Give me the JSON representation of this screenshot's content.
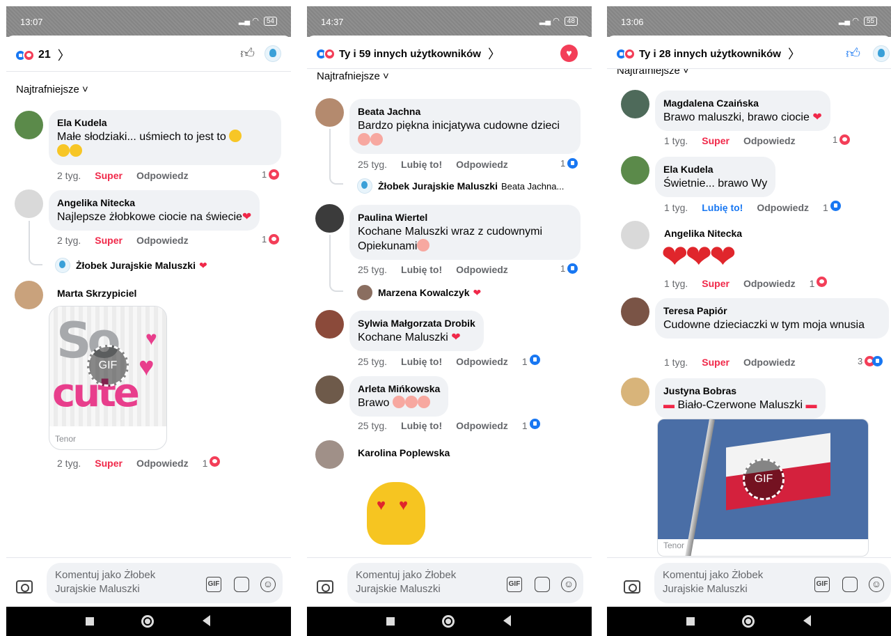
{
  "composer": {
    "placeholder": "Komentuj jako Żłobek Jurajskie Maluszki",
    "gif": "GIF"
  },
  "tenor": "Tenor",
  "gif_label": "GIF",
  "screens": [
    {
      "status_time": "13:07",
      "battery": "54",
      "header_count": "21",
      "sort_label": "Najtrafniejsze ˅",
      "comments": [
        {
          "name": "Ela Kudela",
          "text": "Małe słodziaki... uśmiech to jest to",
          "time": "2 tyg.",
          "reaction_label": "Super",
          "reply": "Odpowiedz",
          "count": "1"
        },
        {
          "name": "Angelika Nitecka",
          "text": "Najlepsze żłobkowe ciocie na świecie",
          "time": "2 tyg.",
          "reaction_label": "Super",
          "reply": "Odpowiedz",
          "count": "1",
          "reply_preview": {
            "name": "Żłobek Jurajskie Maluszki",
            "snippet": ""
          }
        },
        {
          "name": "Marta Skrzypiciel",
          "text": "",
          "time": "2 tyg.",
          "reaction_label": "Super",
          "reply": "Odpowiedz",
          "count": "1",
          "gif_art": "So cute"
        }
      ]
    },
    {
      "status_time": "14:37",
      "battery": "48",
      "header_title": "Ty i 59 innych użytkowników",
      "sort_label": "Najtrafniejsze ˅",
      "comments": [
        {
          "name": "Beata Jachna",
          "text": "Bardzo piękna inicjatywa cudowne dzieci",
          "time": "25 tyg.",
          "reaction_label": "Lubię to!",
          "reply": "Odpowiedz",
          "count": "1",
          "reply_preview": {
            "name": "Żłobek Jurajskie Maluszki",
            "snippet": "Beata Jachna..."
          }
        },
        {
          "name": "Paulina Wiertel",
          "text": "Kochane Maluszki wraz z cudownymi Opiekunami",
          "time": "25 tyg.",
          "reaction_label": "Lubię to!",
          "reply": "Odpowiedz",
          "count": "1",
          "reply_preview": {
            "name": "Marzena Kowalczyk",
            "snippet": ""
          }
        },
        {
          "name": "Sylwia Małgorzata Drobik",
          "text": "Kochane Maluszki",
          "time": "25 tyg.",
          "reaction_label": "Lubię to!",
          "reply": "Odpowiedz",
          "count": "1"
        },
        {
          "name": "Arleta Mińkowska",
          "text": "Brawo",
          "time": "25 tyg.",
          "reaction_label": "Lubię to!",
          "reply": "Odpowiedz",
          "count": "1"
        },
        {
          "name": "Karolina Poplewska",
          "text": ""
        }
      ]
    },
    {
      "status_time": "13:06",
      "battery": "55",
      "header_title": "Ty i 28 innych użytkowników",
      "sort_label": "Najtrafniejsze ˅",
      "comments": [
        {
          "name": "Magdalena Czaińska",
          "text": "Brawo maluszki, brawo ciocie",
          "time": "1 tyg.",
          "reaction_label": "Super",
          "reply": "Odpowiedz",
          "count": "1"
        },
        {
          "name": "Ela Kudela",
          "text": "Świetnie... brawo Wy",
          "time": "1 tyg.",
          "reaction_label": "Lubię to!",
          "reply": "Odpowiedz",
          "count": "1"
        },
        {
          "name": "Angelika Nitecka",
          "text": "",
          "time": "1 tyg.",
          "reaction_label": "Super",
          "reply": "Odpowiedz",
          "count": "1"
        },
        {
          "name": "Teresa Papiór",
          "text": "Cudowne dzieciaczki w tym moja wnusia",
          "time": "1 tyg.",
          "reaction_label": "Super",
          "reply": "Odpowiedz",
          "count": "3"
        },
        {
          "name": "Justyna Bobras",
          "text": "Biało-Czerwone Maluszki",
          "gif": true
        }
      ]
    }
  ]
}
